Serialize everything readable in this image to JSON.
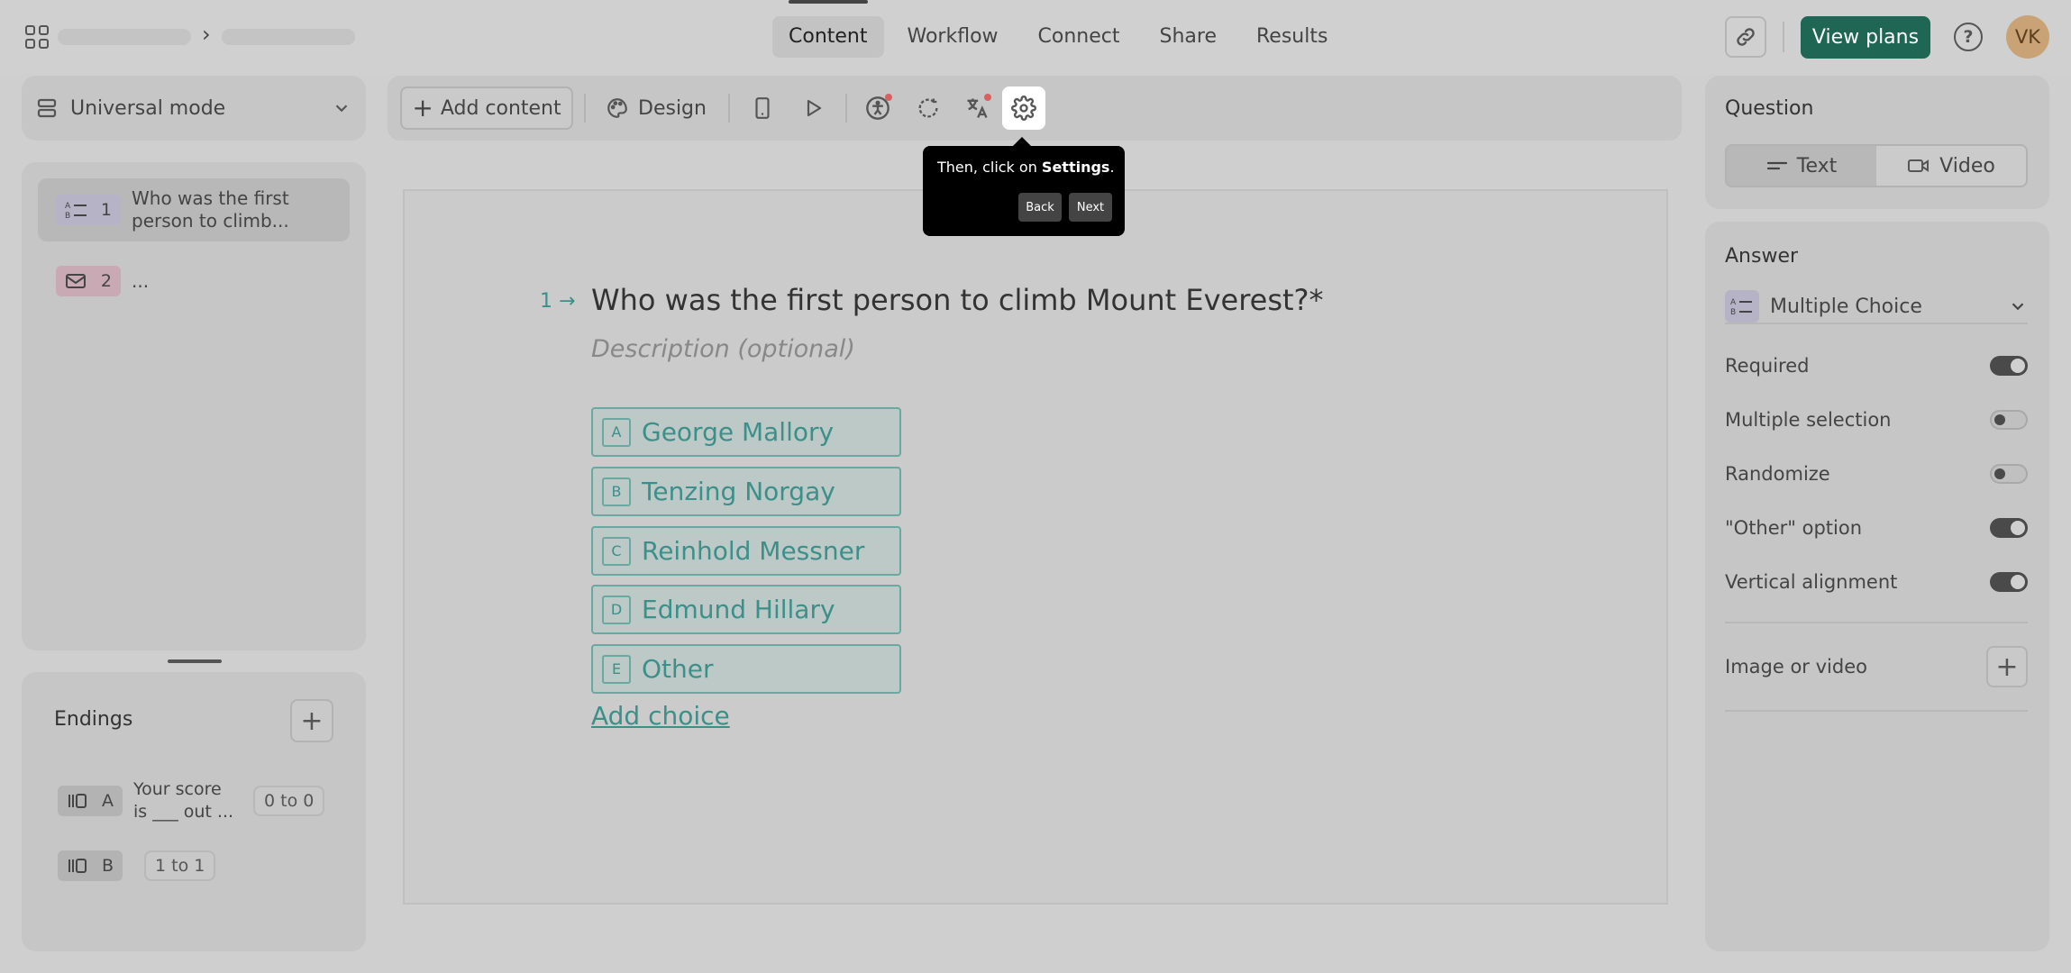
{
  "header": {
    "tabs": [
      {
        "label": "Content",
        "active": true
      },
      {
        "label": "Workflow",
        "active": false
      },
      {
        "label": "Connect",
        "active": false
      },
      {
        "label": "Share",
        "active": false
      },
      {
        "label": "Results",
        "active": false
      }
    ],
    "view_plans_label": "View plans",
    "avatar_initials": "VK",
    "help_glyph": "?"
  },
  "sidebar": {
    "mode_label": "Universal mode",
    "questions": [
      {
        "number": "1",
        "text_line1": "Who was the first",
        "text_line2": "person to climb...",
        "icon": "multiple-choice-icon",
        "color": "#b7b3c6"
      },
      {
        "number": "2",
        "text_line1": "...",
        "text_line2": "",
        "icon": "mail-icon",
        "color": "#c9a9b3"
      }
    ],
    "endings": {
      "title": "Endings",
      "items": [
        {
          "key": "A",
          "text_line1": "Your score",
          "text_line2": "is ___ out ...",
          "range": "0 to 0"
        },
        {
          "key": "B",
          "text_line1": "",
          "text_line2": "",
          "range": "1 to 1"
        }
      ]
    }
  },
  "toolbar": {
    "add_content_label": "Add content",
    "design_label": "Design"
  },
  "tooltip": {
    "text_prefix": "Then, click on ",
    "text_bold": "Settings",
    "text_suffix": ".",
    "back_label": "Back",
    "next_label": "Next"
  },
  "question": {
    "number": "1",
    "title": "Who was the first person to climb Mount Everest?*",
    "description_placeholder": "Description (optional)",
    "choices": [
      {
        "key": "A",
        "label": "George Mallory"
      },
      {
        "key": "B",
        "label": "Tenzing Norgay"
      },
      {
        "key": "C",
        "label": "Reinhold Messner"
      },
      {
        "key": "D",
        "label": "Edmund Hillary"
      },
      {
        "key": "E",
        "label": "Other"
      }
    ],
    "add_choice_label": "Add choice"
  },
  "right_panel": {
    "question_title": "Question",
    "format_text": "Text",
    "format_video": "Video",
    "answer_title": "Answer",
    "answer_type": "Multiple Choice",
    "options": [
      {
        "label": "Required",
        "on": true
      },
      {
        "label": "Multiple selection",
        "on": false
      },
      {
        "label": "Randomize",
        "on": false
      },
      {
        "label": "\"Other\" option",
        "on": true
      },
      {
        "label": "Vertical alignment",
        "on": true
      }
    ],
    "image_video_label": "Image or video"
  },
  "colors": {
    "accent_teal": "#3d8f8a",
    "view_plans_bg": "#1f6655",
    "notification_dot": "#d96060"
  }
}
